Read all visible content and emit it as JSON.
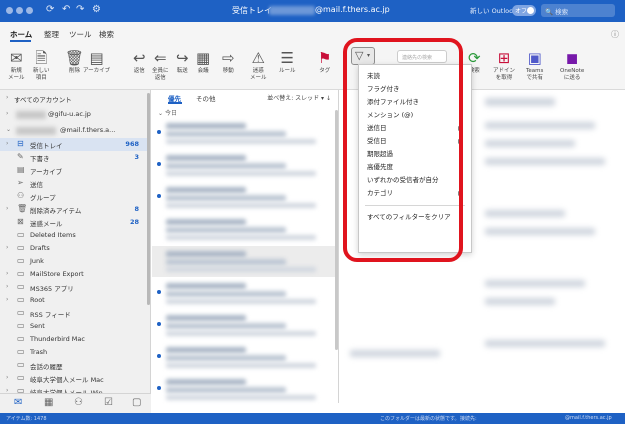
{
  "titlebar": {
    "title": "受信トレイ・",
    "email_suffix": "@mail.f.thers.ac.jp",
    "new_outlook_label": "新しい Outlook",
    "toggle_label": "オフ",
    "search_placeholder": "検索"
  },
  "ribbon": {
    "tabs": [
      "ホーム",
      "整理",
      "ツール",
      "検索"
    ],
    "buttons": [
      {
        "label": "新規\nメール",
        "icon": "envelope-icon"
      },
      {
        "label": "新しい\n項目",
        "icon": "new-items-icon"
      },
      {
        "label": "削除",
        "icon": "trash-icon"
      },
      {
        "label": "アーカイブ",
        "icon": "archive-icon"
      },
      {
        "label": "返信",
        "icon": "reply-icon"
      },
      {
        "label": "全員に\n返信",
        "icon": "reply-all-icon"
      },
      {
        "label": "転送",
        "icon": "forward-icon"
      },
      {
        "label": "会議",
        "icon": "meeting-icon"
      },
      {
        "label": "移動",
        "icon": "move-icon"
      },
      {
        "label": "迷惑\nメール",
        "icon": "junk-icon"
      },
      {
        "label": "ルール",
        "icon": "rules-icon"
      },
      {
        "label": "タグ",
        "icon": "flag-icon"
      },
      {
        "label": "フィルター",
        "icon": "filter-icon"
      },
      {
        "label": "検索",
        "icon": "search-icon"
      },
      {
        "label": "アドイン\nを取得",
        "icon": "add-in-icon"
      },
      {
        "label": "Teams\nで共有",
        "icon": "teams-icon"
      },
      {
        "label": "OneNote\nに送る",
        "icon": "onenote-icon"
      }
    ],
    "filter_search_placeholder": "連絡先の検索"
  },
  "folders": {
    "all_accounts": "すべてのアカウント",
    "account1": "@gifu-u.ac.jp",
    "account2": "@mail.f.thers.a...",
    "items": [
      {
        "name": "受信トレイ",
        "count": "968",
        "icon": "inbox-icon"
      },
      {
        "name": "下書き",
        "count": "3",
        "icon": "draft-icon"
      },
      {
        "name": "アーカイブ",
        "count": "",
        "icon": "archive-icon"
      },
      {
        "name": "送信",
        "count": "",
        "icon": "sent-icon"
      },
      {
        "name": "グループ",
        "count": "",
        "icon": "group-icon"
      },
      {
        "name": "削除済みアイテム",
        "count": "8",
        "icon": "trash-icon"
      },
      {
        "name": "迷惑メール",
        "count": "28",
        "icon": "junk-icon"
      },
      {
        "name": "Deleted Items",
        "count": "",
        "icon": "folder-icon"
      },
      {
        "name": "Drafts",
        "count": "",
        "icon": "folder-icon"
      },
      {
        "name": "Junk",
        "count": "",
        "icon": "folder-icon"
      },
      {
        "name": "MailStore Export",
        "count": "",
        "icon": "folder-icon"
      },
      {
        "name": "MS365 アプリ",
        "count": "",
        "icon": "folder-icon"
      },
      {
        "name": "Root",
        "count": "",
        "icon": "folder-icon"
      },
      {
        "name": "RSS フィード",
        "count": "",
        "icon": "folder-icon"
      },
      {
        "name": "Sent",
        "count": "",
        "icon": "folder-icon"
      },
      {
        "name": "Thunderbird Mac",
        "count": "",
        "icon": "folder-icon"
      },
      {
        "name": "Trash",
        "count": "",
        "icon": "folder-icon"
      },
      {
        "name": "会話の履歴",
        "count": "",
        "icon": "folder-icon"
      },
      {
        "name": "岐阜大学個人メール Mac",
        "count": "",
        "icon": "folder-icon"
      },
      {
        "name": "岐阜大学個人メール Win",
        "count": "",
        "icon": "folder-icon"
      }
    ]
  },
  "message_list": {
    "tab_focused": "優先",
    "tab_other": "その他",
    "sort_label": "並べ替え: スレッド",
    "group_today": "今日"
  },
  "filter_menu": {
    "items": [
      {
        "label": "未読",
        "submenu": false
      },
      {
        "label": "フラグ付き",
        "submenu": false
      },
      {
        "label": "添付ファイル付き",
        "submenu": false
      },
      {
        "label": "メンション (@)",
        "submenu": false
      },
      {
        "label": "送信日",
        "submenu": true
      },
      {
        "label": "受信日",
        "submenu": true
      },
      {
        "label": "期限超過",
        "submenu": false
      },
      {
        "label": "高優先度",
        "submenu": false
      },
      {
        "label": "いずれかの受信者が自分",
        "submenu": false
      },
      {
        "label": "カテゴリ",
        "submenu": true
      }
    ],
    "clear_label": "すべてのフィルターをクリア"
  },
  "statusbar": {
    "item_count": "アイテム数: 1478",
    "sync_status": "このフォルダーは最新の状態です。",
    "connected_label": "接続先:",
    "account": "@mail.f.thers.ac.jp"
  },
  "colors": {
    "accent": "#1e61c4",
    "highlight": "#e0141e"
  }
}
